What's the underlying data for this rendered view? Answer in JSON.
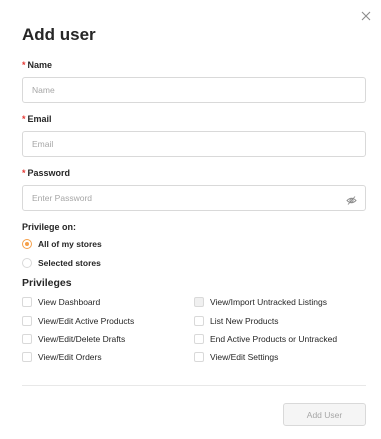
{
  "dialog": {
    "title": "Add user"
  },
  "form": {
    "name": {
      "label": "Name",
      "placeholder": "Name",
      "value": ""
    },
    "email": {
      "label": "Email",
      "placeholder": "Email",
      "value": ""
    },
    "password": {
      "label": "Password",
      "placeholder": "Enter Password",
      "value": ""
    },
    "required_marker": "*"
  },
  "privilege_on": {
    "label": "Privilege on:",
    "options": [
      "All of my stores",
      "Selected stores"
    ],
    "selected": "All of my stores"
  },
  "privileges": {
    "heading": "Privileges",
    "left": [
      "View Dashboard",
      "View/Edit Active Products",
      "View/Edit/Delete Drafts",
      "View/Edit Orders"
    ],
    "right": [
      "View/Import Untracked Listings",
      "List New Products",
      "End Active Products or Untracked",
      "View/Edit Settings"
    ]
  },
  "actions": {
    "submit_label": "Add User"
  },
  "colors": {
    "accent": "#f5a04a",
    "required": "#e53935",
    "border": "#d9d9d9",
    "disabled_text": "#a6a6a6"
  }
}
